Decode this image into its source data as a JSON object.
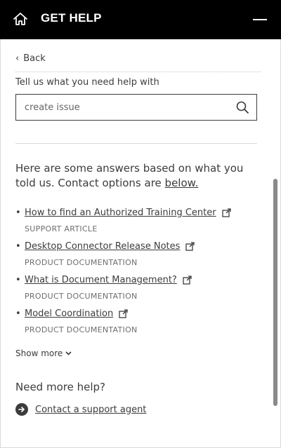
{
  "header": {
    "title": "GET HELP",
    "home_icon": "home-icon",
    "minimize_icon": "minimize-icon",
    "background": "#000000"
  },
  "nav": {
    "back_label": "Back"
  },
  "search": {
    "prompt": "Tell us what you need help with",
    "value": "create issue",
    "icon": "search-icon"
  },
  "answers": {
    "intro": "Here are some answers based on what you told us. Contact options are ",
    "below_link": "below.",
    "items": [
      {
        "title": "How to find an Authorized Training Center",
        "type": "SUPPORT ARTICLE"
      },
      {
        "title": "Desktop Connector Release Notes",
        "type": "PRODUCT DOCUMENTATION"
      },
      {
        "title": "What is Document Management?",
        "type": "PRODUCT DOCUMENTATION"
      },
      {
        "title": "Model Coordination",
        "type": "PRODUCT DOCUMENTATION"
      }
    ],
    "show_more": "Show more"
  },
  "contact": {
    "heading": "Need more help?",
    "link_label": "Contact a support agent",
    "icon": "arrow-right-circle-icon"
  }
}
